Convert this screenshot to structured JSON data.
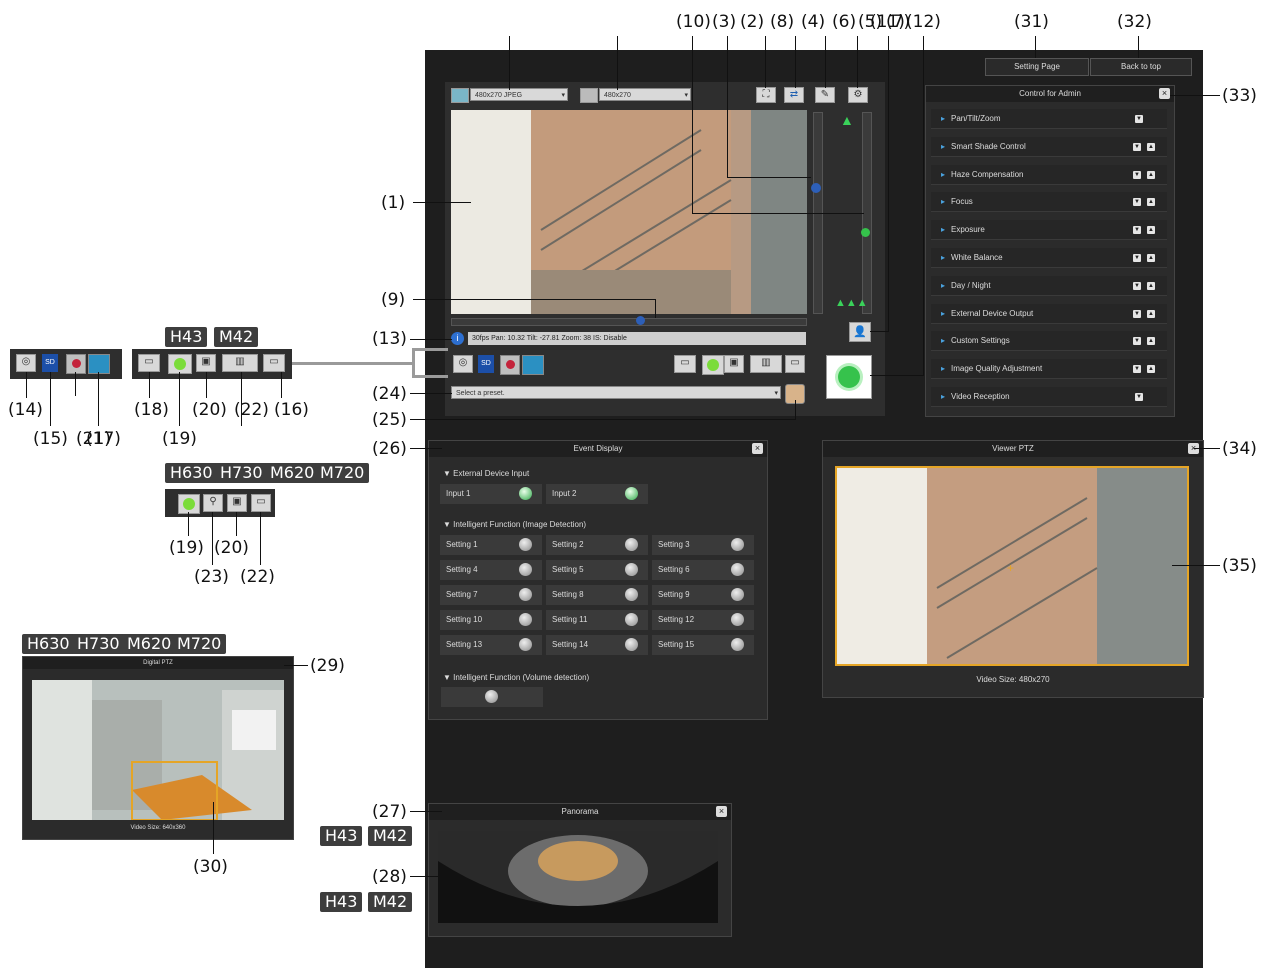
{
  "callouts": {
    "c1": "(1)",
    "c2": "(2)",
    "c3": "(3)",
    "c4": "(4)",
    "c5": "(5)",
    "c6": "(6)",
    "c7": "(7)",
    "c8": "(8)",
    "c9": "(9)",
    "c10": "(10)",
    "c11": "(11)",
    "c12": "(12)",
    "c13": "(13)",
    "c14": "(14)",
    "c15": "(15)",
    "c16": "(16)",
    "c17": "(17)",
    "c18": "(18)",
    "c19": "(19)",
    "c20": "(20)",
    "c21": "(21)",
    "c22": "(22)",
    "c24": "(24)",
    "c25": "(25)",
    "c26": "(26)",
    "c27": "(27)",
    "c28": "(28)",
    "c29": "(29)",
    "c30": "(30)",
    "c31": "(31)",
    "c32": "(32)",
    "c33": "(33)",
    "c34": "(34)",
    "c35": "(35)",
    "b19": "(19)",
    "b20": "(20)",
    "b22": "(22)",
    "b23": "(23)"
  },
  "model_tags": {
    "h43": "H43",
    "m42": "M42",
    "h630": "H630",
    "h730": "H730",
    "m620": "M620",
    "m720": "M720"
  },
  "header": {
    "setting_page": "Setting Page",
    "back_to_top": "Back to top"
  },
  "video": {
    "stream_select": "480x270 JPEG",
    "size_select": "480x270",
    "status_text": "30fps Pan: 10.32 Tilt: -27.81 Zoom: 38 IS: Disable",
    "preset_placeholder": "Select a preset."
  },
  "admin": {
    "title": "Control for Admin",
    "items": [
      "Pan/Tilt/Zoom",
      "Smart Shade Control",
      "Haze Compensation",
      "Focus",
      "Exposure",
      "White Balance",
      "Day / Night",
      "External Device Output",
      "Custom Settings",
      "Image Quality Adjustment",
      "Video Reception"
    ]
  },
  "event_display": {
    "title": "Event Display",
    "section_external": "External Device Input",
    "inputs": [
      "Input 1",
      "Input 2"
    ],
    "section_intelligent": "Intelligent Function (Image Detection)",
    "settings": [
      "Setting 1",
      "Setting 2",
      "Setting 3",
      "Setting 4",
      "Setting 5",
      "Setting 6",
      "Setting 7",
      "Setting 8",
      "Setting 9",
      "Setting 10",
      "Setting 11",
      "Setting 12",
      "Setting 13",
      "Setting 14",
      "Setting 15"
    ],
    "section_volume": "Intelligent Function (Volume detection)"
  },
  "viewer_ptz": {
    "title": "Viewer PTZ",
    "video_size": "Video Size: 480x270"
  },
  "digital_ptz": {
    "title": "Digital PTZ",
    "video_size": "Video Size: 640x360"
  },
  "panorama": {
    "title": "Panorama"
  },
  "small_labels": {
    "sd": "SD"
  }
}
